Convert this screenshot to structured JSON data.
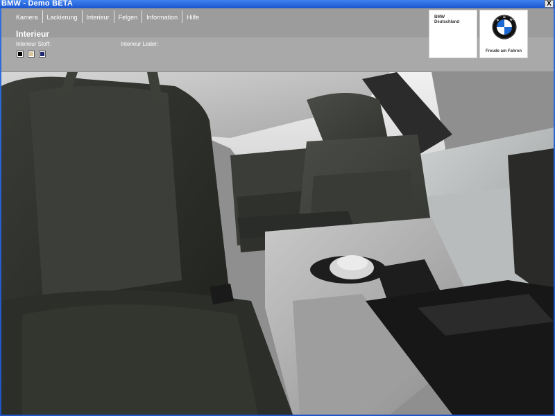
{
  "window": {
    "title": "BMW - Demo BETA",
    "close_label": "X"
  },
  "nav": {
    "items": [
      "Kamera",
      "Lackierung",
      "Interieur",
      "Felgen",
      "Information",
      "Hilfe"
    ]
  },
  "panel": {
    "section_title": "Interieur",
    "stoff_label": "Interieur Stoff:",
    "leder_label": "Interieur Leder:",
    "stoff_swatches": [
      {
        "color": "#000000"
      },
      {
        "color": "#d8c79a"
      },
      {
        "color": "#1f2a6e"
      }
    ]
  },
  "branding": {
    "company_line1": "BMW",
    "company_line2": "Deutschland",
    "slogan": "Freude am Fahren"
  }
}
